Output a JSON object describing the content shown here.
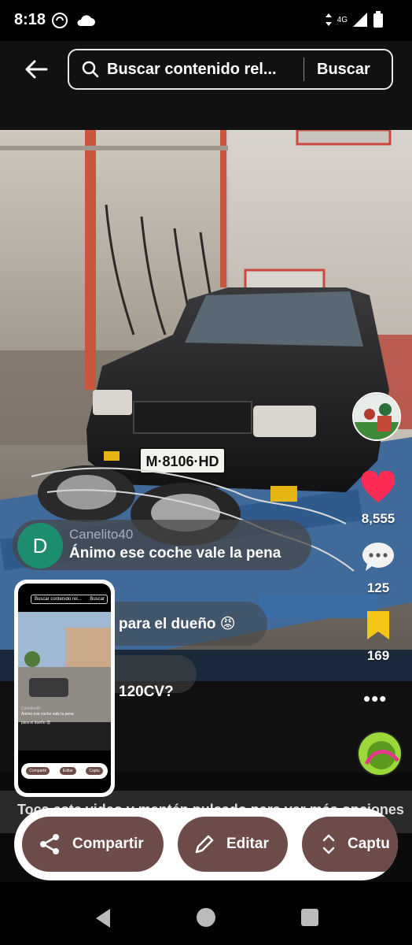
{
  "status": {
    "time": "8:18",
    "network": "4G",
    "icons": [
      "cloud-sync-icon",
      "cloud-icon",
      "data-arrows-icon",
      "signal-icon",
      "battery-icon"
    ]
  },
  "header": {
    "search_placeholder": "Buscar contenido rel...",
    "search_button": "Buscar",
    "icons": [
      "back-arrow-icon",
      "search-icon"
    ]
  },
  "video": {
    "license_plate": "M·8106·HD"
  },
  "actions": {
    "likes": "8,555",
    "comments": "125",
    "saves": "169",
    "more": "•••",
    "colors": {
      "like": "#fe2c55",
      "save": "#f5c518"
    }
  },
  "comments": [
    {
      "avatar_letter": "D",
      "user": "Canelito40",
      "text": "Ánimo ese coche vale la pena"
    },
    {
      "text": "para el dueño 😡"
    },
    {
      "text": "120CV?"
    }
  ],
  "hint": {
    "text": "Toca este video y mantén pulsado para ver más opciones"
  },
  "thumbnail": {
    "search_placeholder": "Buscar contenido rel...",
    "search_button": "Buscar",
    "comment_user": "Canelito40",
    "comment_text": "Ánimo ese coche vale la pena",
    "comment2": "para el dueño 😡",
    "buttons": [
      "Compartir",
      "Editar",
      "Captu"
    ]
  },
  "toolbar": {
    "share_label": "Compartir",
    "edit_label": "Editar",
    "capture_label": "Captu"
  },
  "navbar": {
    "icons": [
      "nav-back-icon",
      "nav-home-icon",
      "nav-recents-icon"
    ]
  }
}
